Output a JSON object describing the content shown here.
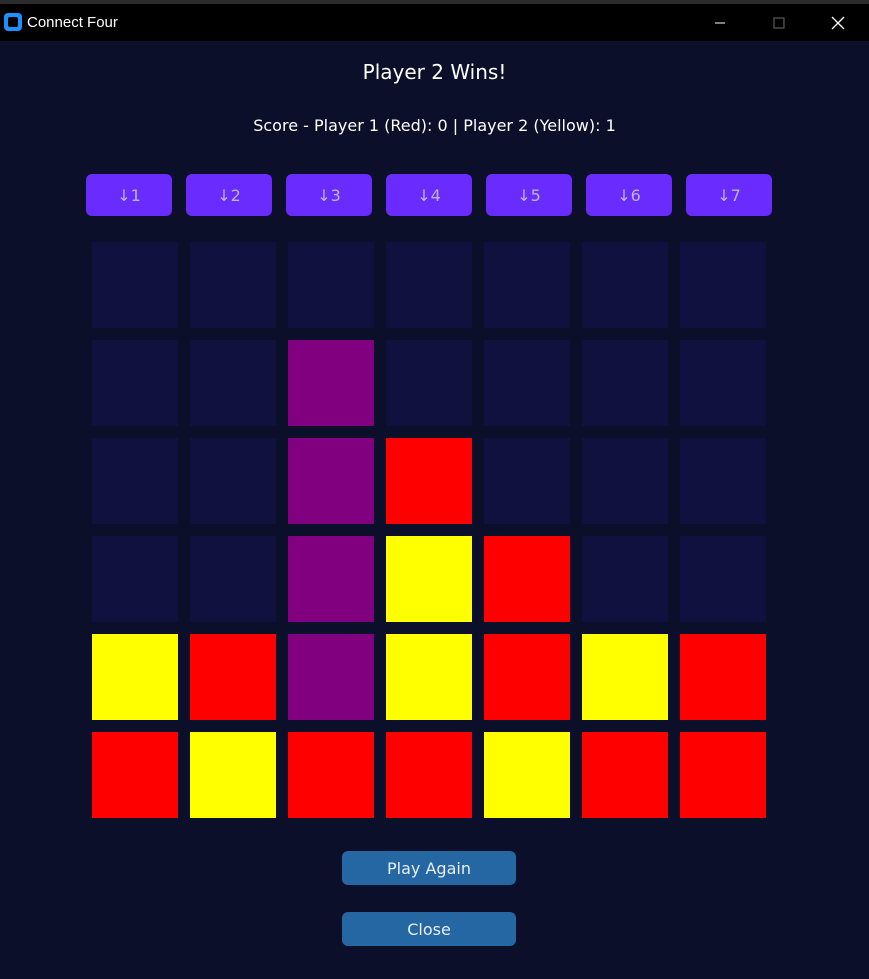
{
  "window": {
    "title": "Connect Four"
  },
  "status_text": "Player 2 Wins!",
  "score_text": "Score - Player 1 (Red): 0 | Player 2 (Yellow): 1",
  "column_buttons": [
    "↓1",
    "↓2",
    "↓3",
    "↓4",
    "↓5",
    "↓6",
    "↓7"
  ],
  "colors": {
    "empty": "#10113f",
    "red": "#ff0000",
    "yellow": "#ffff00",
    "winning": "#800080",
    "column_button": "#6a2bff",
    "action_button": "#2467a3"
  },
  "board": [
    [
      "empty",
      "empty",
      "empty",
      "empty",
      "empty",
      "empty",
      "empty"
    ],
    [
      "empty",
      "empty",
      "winning",
      "empty",
      "empty",
      "empty",
      "empty"
    ],
    [
      "empty",
      "empty",
      "winning",
      "red",
      "empty",
      "empty",
      "empty"
    ],
    [
      "empty",
      "empty",
      "winning",
      "yellow",
      "red",
      "empty",
      "empty"
    ],
    [
      "yellow",
      "red",
      "winning",
      "yellow",
      "red",
      "yellow",
      "red"
    ],
    [
      "red",
      "yellow",
      "red",
      "red",
      "yellow",
      "red",
      "red"
    ]
  ],
  "actions": {
    "play_again": "Play Again",
    "close": "Close"
  }
}
